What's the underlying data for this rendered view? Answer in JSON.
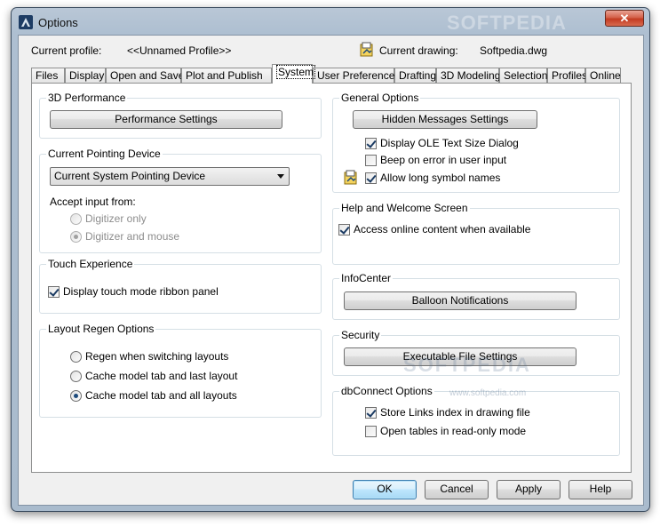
{
  "window": {
    "title": "Options",
    "watermark": "SOFTPEDIA"
  },
  "profile": {
    "current_profile_label": "Current profile:",
    "current_profile_value": "<<Unnamed Profile>>",
    "current_drawing_label": "Current drawing:",
    "current_drawing_value": "Softpedia.dwg"
  },
  "tabs": [
    "Files",
    "Display",
    "Open and Save",
    "Plot and Publish",
    "System",
    "User Preferences",
    "Drafting",
    "3D Modeling",
    "Selection",
    "Profiles",
    "Online"
  ],
  "active_tab": "System",
  "left": {
    "perf": {
      "title": "3D Performance",
      "button": "Performance Settings"
    },
    "pointing": {
      "title": "Current Pointing Device",
      "select_value": "Current System Pointing Device",
      "accept_label": "Accept input from:",
      "options": [
        "Digitizer only",
        "Digitizer and mouse"
      ]
    },
    "touch": {
      "title": "Touch Experience",
      "checkbox": "Display touch mode ribbon panel"
    },
    "regen": {
      "title": "Layout Regen Options",
      "options": [
        "Regen when switching layouts",
        "Cache model tab and last layout",
        "Cache model tab and all layouts"
      ]
    }
  },
  "right": {
    "general": {
      "title": "General Options",
      "button": "Hidden Messages Settings",
      "checks": [
        "Display OLE Text Size Dialog",
        "Beep on error in user input",
        "Allow long symbol names"
      ]
    },
    "help": {
      "title": "Help and Welcome Screen",
      "checkbox": "Access online content when available"
    },
    "infocenter": {
      "title": "InfoCenter",
      "button": "Balloon Notifications"
    },
    "security": {
      "title": "Security",
      "button": "Executable File Settings"
    },
    "dbconnect": {
      "title": "dbConnect Options",
      "checks": [
        "Store Links index in drawing file",
        "Open tables in read-only mode"
      ]
    }
  },
  "watermark_panel": {
    "big": "SOFTPEDIA",
    "small": "www.softpedia.com"
  },
  "footer": {
    "ok": "OK",
    "cancel": "Cancel",
    "apply": "Apply",
    "help": "Help"
  },
  "colors": {
    "frame": "#aebfd1",
    "close": "#c33b22",
    "accent_border": "#3c7fb1"
  }
}
